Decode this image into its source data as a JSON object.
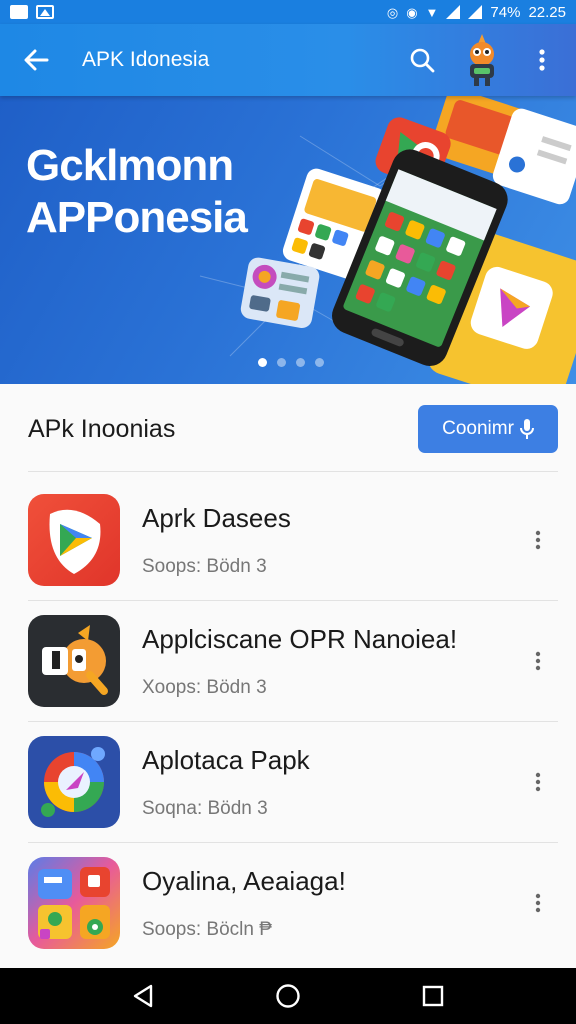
{
  "status_bar": {
    "battery": "74%",
    "time": "22.25"
  },
  "app_bar": {
    "title": "APK Idonesia",
    "icons": [
      "back-arrow-icon",
      "search-icon",
      "mascot-icon",
      "more-vert-icon"
    ]
  },
  "banner": {
    "title_line1": "Gcklmonn",
    "title_line2": "APPonesia",
    "page_count": 4,
    "active_page": 1
  },
  "section": {
    "title": "APk Inoonias",
    "connect_label": "Coonimr",
    "connect_icon": "mic-icon"
  },
  "apps": [
    {
      "name": "Aprk Dasees",
      "sub": "Soops: Bödn 3",
      "icon": "play-store-icon"
    },
    {
      "name": "Applciscane OPR Nanoiea!",
      "sub": "Xoops: Bödn 3",
      "icon": "mascot-app-icon"
    },
    {
      "name": "Aplotaca Papk",
      "sub": "Soqna: Bödn 3",
      "icon": "colorful-compass-icon"
    },
    {
      "name": "Oyalina, Aeaiaga!",
      "sub": "Soops: Böcln ₱",
      "icon": "widgets-app-icon"
    }
  ],
  "colors": {
    "primary": "#1e88e5",
    "button": "#3d7fe3",
    "nav_bar": "#000000"
  }
}
